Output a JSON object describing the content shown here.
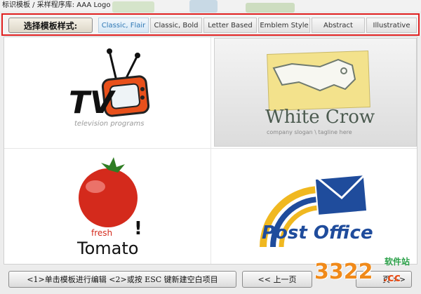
{
  "window": {
    "title": "标识模板 / 采样程序库: AAA Logo"
  },
  "toolbar": {
    "select_label": "选择模板样式:",
    "tabs": [
      {
        "label": "Classic, Flair",
        "active": true
      },
      {
        "label": "Classic, Bold",
        "active": false
      },
      {
        "label": "Letter Based",
        "active": false
      },
      {
        "label": "Emblem Style",
        "active": false
      },
      {
        "label": "Abstract",
        "active": false
      },
      {
        "label": "Illustrative",
        "active": false
      }
    ]
  },
  "templates": [
    {
      "id": "tv",
      "logo_text": "TV",
      "tagline": "television programs",
      "selected": false
    },
    {
      "id": "white-crow",
      "logo_text": "White Crow",
      "tagline": "company slogan \\ tagline here",
      "selected": true
    },
    {
      "id": "tomato",
      "logo_top": "fresh",
      "logo_text": "Tomato",
      "logo_mark": "!",
      "selected": false
    },
    {
      "id": "post-office",
      "logo_text": "Post Office",
      "selected": false
    }
  ],
  "bottom": {
    "edit_hint": "<1>单击模板进行编辑 <2>或按 ESC 键新建空白项目",
    "prev_label": "<< 上一页",
    "next_label": "页 >>"
  },
  "watermark": {
    "text": "3322",
    "suffix": ".cc",
    "label": "软件站"
  },
  "colors": {
    "red_frame": "#e02020",
    "tab_active_text": "#2f78b5",
    "tomato_red": "#d42a1c",
    "post_blue": "#1f4c9c"
  }
}
